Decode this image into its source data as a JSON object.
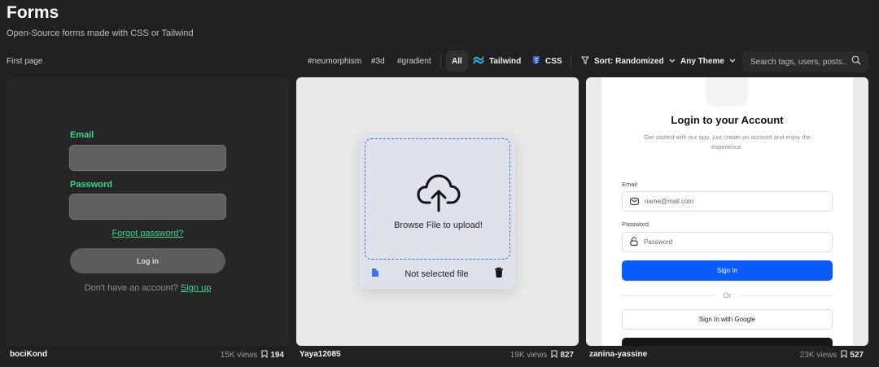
{
  "header": {
    "title": "Forms",
    "subtitle": "Open-Source forms made with CSS or Tailwind"
  },
  "toolbar": {
    "first_page": "First page",
    "tags": [
      "#neumorphism",
      "#3d",
      "#gradient"
    ],
    "filters": {
      "all": "All",
      "tailwind": "Tailwind",
      "css": "CSS",
      "sort": "Sort: Randomized",
      "theme": "Any Theme"
    },
    "search_placeholder": "Search tags, users, posts..."
  },
  "colors": {
    "accent_green": "#3dd68c",
    "tailwind_blue": "#38bdf8",
    "css_blue": "#2965f1",
    "signin_blue": "#0b5cff"
  },
  "cards": [
    {
      "author": "bociKond",
      "views": "15K views",
      "saves": "194",
      "form": {
        "email_label": "Email",
        "password_label": "Password",
        "forgot": "Forgot password?",
        "login": "Log in",
        "no_account": "Don't have an account?",
        "signup": "Sign up"
      }
    },
    {
      "author": "Yaya12085",
      "views": "19K views",
      "saves": "827",
      "form": {
        "browse": "Browse File to upload!",
        "file_status": "Not selected file"
      }
    },
    {
      "author": "zanina-yassine",
      "views": "23K views",
      "saves": "527",
      "form": {
        "title": "Login to your Account",
        "subtitle": "Get started with our app, just create an account and enjoy the experience.",
        "email_label": "Email",
        "email_placeholder": "name@mail.com",
        "password_label": "Password",
        "password_placeholder": "Password",
        "signin": "Sign In",
        "or": "Or",
        "google": "Sign In with Google"
      }
    }
  ]
}
